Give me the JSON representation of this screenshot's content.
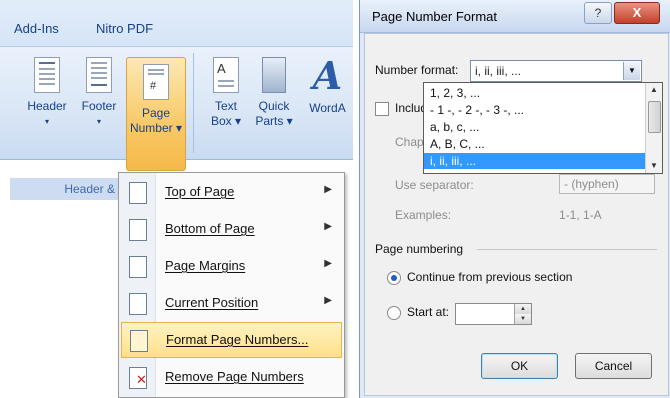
{
  "ribbon": {
    "tabs": [
      "Add-Ins",
      "Nitro PDF"
    ],
    "buttons": {
      "header": {
        "line1": "Header",
        "line2": "▾"
      },
      "footer": {
        "line1": "Footer",
        "line2": "▾"
      },
      "page_number": {
        "line1": "Page",
        "line2": "Number ▾"
      },
      "text_box": {
        "line1": "Text",
        "line2": "Box ▾"
      },
      "quick_parts": {
        "line1": "Quick",
        "line2": "Parts ▾"
      },
      "wordart": {
        "line1": "WordA"
      }
    },
    "group_label": "Header & F"
  },
  "menu": {
    "items": [
      {
        "label": "Top of Page",
        "has_submenu": true
      },
      {
        "label": "Bottom of Page",
        "has_submenu": true
      },
      {
        "label": "Page Margins",
        "has_submenu": true
      },
      {
        "label": "Current Position",
        "has_submenu": true
      },
      {
        "label": "Format Page Numbers...",
        "highlighted": true
      },
      {
        "label": "Remove Page Numbers"
      }
    ]
  },
  "dialog": {
    "title": "Page Number Format",
    "help": "?",
    "close": "X",
    "number_format_label": "Number format:",
    "number_format_value": "i, ii, iii, ...",
    "number_format_options": [
      "1, 2, 3, ...",
      "- 1 -, - 2 -, - 3 -, ...",
      "a, b, c, ...",
      "A, B, C, ...",
      "i, ii, iii, ..."
    ],
    "include_chapter_label": "Include chapte",
    "chapter_starts_label": "Chapter starts",
    "use_separator_label": "Use separator:",
    "separator_value": "-   (hyphen)",
    "examples_label": "Examples:",
    "examples_value": "1-1, 1-A",
    "page_numbering_label": "Page numbering",
    "continue_label": "Continue from previous section",
    "start_at_label": "Start at:",
    "ok_label": "OK",
    "cancel_label": "Cancel"
  }
}
